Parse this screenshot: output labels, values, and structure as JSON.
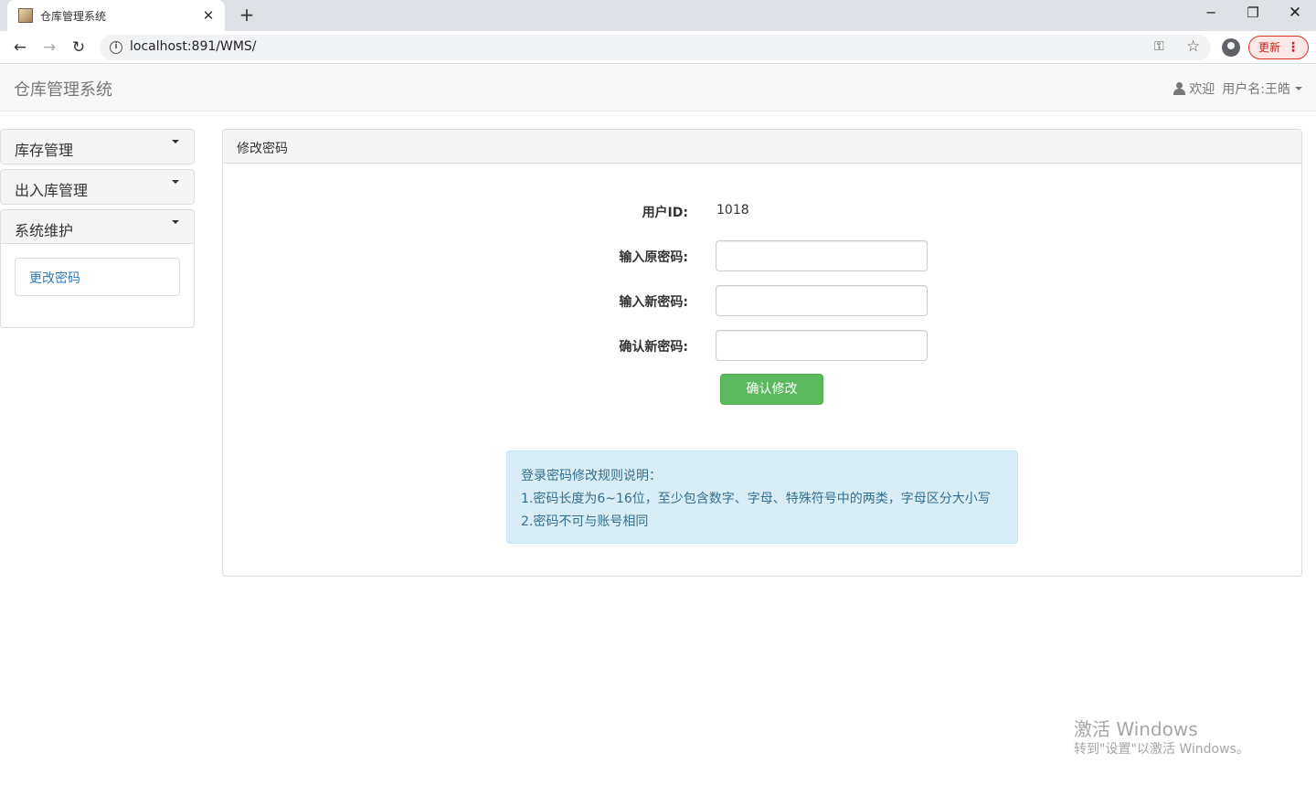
{
  "browser": {
    "tab_title": "仓库管理系统",
    "url": "localhost:891/WMS/",
    "update_label": "更新"
  },
  "navbar": {
    "brand": "仓库管理系统",
    "welcome": "欢迎",
    "username": "用户名:王皓"
  },
  "sidebar": {
    "sections": [
      {
        "label": "库存管理"
      },
      {
        "label": "出入库管理"
      },
      {
        "label": "系统维护",
        "items": [
          {
            "label": "更改密码"
          }
        ]
      }
    ]
  },
  "panel": {
    "title": "修改密码",
    "user_id_label": "用户ID:",
    "user_id_value": "1018",
    "old_password_label": "输入原密码:",
    "new_password_label": "输入新密码:",
    "confirm_password_label": "确认新密码:",
    "submit_label": "确认修改",
    "rules": {
      "heading": "登录密码修改规则说明：",
      "rule1": "1.密码长度为6~16位，至少包含数字、字母、特殊符号中的两类，字母区分大小写",
      "rule2": "2.密码不可与账号相同"
    }
  },
  "watermark": {
    "title": "激活 Windows",
    "subtitle": "转到\"设置\"以激活 Windows。"
  },
  "colors": {
    "success": "#5cb85c",
    "info_bg": "#d9edf7",
    "info_text": "#31708f",
    "link": "#337ab7"
  }
}
